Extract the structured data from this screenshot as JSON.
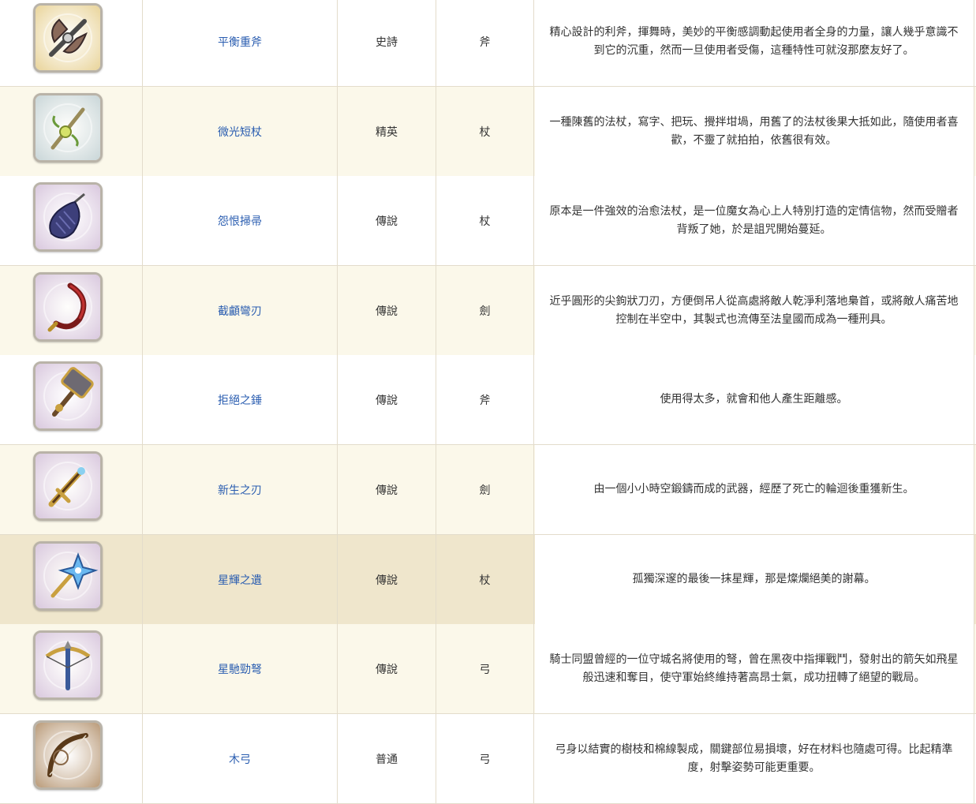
{
  "columns": [
    "icon",
    "name",
    "rarity",
    "type",
    "description"
  ],
  "rows": [
    {
      "icon": "heavy-axe-icon",
      "name": "平衡重斧",
      "rarity": "史詩",
      "type": "斧",
      "desc": "精心設計的利斧，揮舞時，美妙的平衡感調動起使用者全身的力量，讓人幾乎意識不到它的沉重，然而一旦使用者受傷，這種特性可就沒那麼友好了。",
      "bg": "#e9d49a"
    },
    {
      "icon": "staff-icon",
      "name": "微光短杖",
      "rarity": "精英",
      "type": "杖",
      "desc": "一種陳舊的法杖，寫字、把玩、攪拌坩堝，用舊了的法杖後果大抵如此，隨使用者喜歡，不靈了就拍拍，依舊很有效。",
      "bg": "#c9d6d8"
    },
    {
      "icon": "broom-icon",
      "name": "怨恨掃帚",
      "rarity": "傳說",
      "type": "杖",
      "desc": "原本是一件強效的治愈法杖，是一位魔女為心上人特別打造的定情信物，然而受贈者背叛了她，於是詛咒開始蔓延。",
      "bg": "#d9c8de"
    },
    {
      "icon": "sickle-icon",
      "name": "截顱彎刃",
      "rarity": "傳說",
      "type": "劍",
      "desc": "近乎圓形的尖鉤狀刀刃，方便倒吊人從高處將敵人乾淨利落地梟首，或將敵人痛苦地控制在半空中，其製式也流傳至法皇國而成為一種刑具。",
      "bg": "#d9c8de"
    },
    {
      "icon": "hammer-icon",
      "name": "拒絕之錘",
      "rarity": "傳說",
      "type": "斧",
      "desc": "使用得太多，就會和他人產生距離感。",
      "bg": "#d9c8de"
    },
    {
      "icon": "sword-icon",
      "name": "新生之刃",
      "rarity": "傳說",
      "type": "劍",
      "desc": "由一個小小時空鍛鑄而成的武器，經歷了死亡的輪迴後重獲新生。",
      "bg": "#d9c8de"
    },
    {
      "icon": "star-staff-icon",
      "name": "星輝之遺",
      "rarity": "傳說",
      "type": "杖",
      "desc": "孤獨深邃的最後一抹星輝，那是燦爛絕美的謝幕。",
      "bg": "#d9c8de"
    },
    {
      "icon": "crossbow-icon",
      "name": "星馳勁弩",
      "rarity": "傳說",
      "type": "弓",
      "desc": "騎士同盟曾經的一位守城名將使用的弩，曾在黑夜中指揮戰鬥，發射出的箭矢如飛星般迅速和奪目，使守軍始終維持著高昂士氣，成功扭轉了絕望的戰局。",
      "bg": "#d9c8de"
    },
    {
      "icon": "wooden-bow-icon",
      "name": "木弓",
      "rarity": "普通",
      "type": "弓",
      "desc": "弓身以結實的樹枝和棉線製成，關鍵部位易損壞，好在材料也隨處可得。比起精準度，射擊姿勢可能更重要。",
      "bg": "#b99a78"
    }
  ]
}
